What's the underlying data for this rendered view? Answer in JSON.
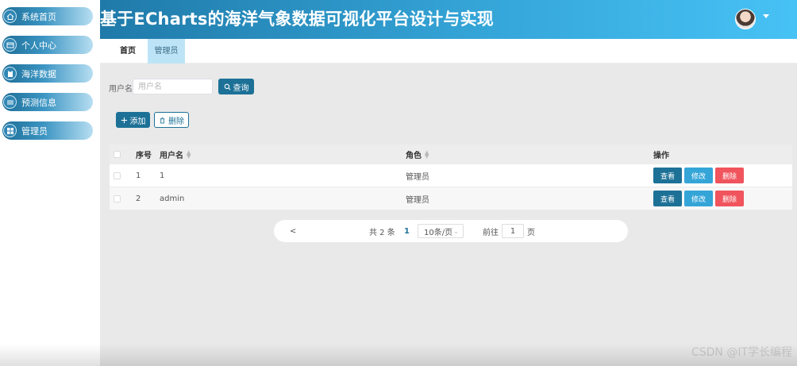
{
  "sidebar": {
    "items": [
      {
        "label": "系统首页",
        "icon": "home-icon"
      },
      {
        "label": "个人中心",
        "icon": "user-card-icon"
      },
      {
        "label": "海洋数据",
        "icon": "clipboard-icon"
      },
      {
        "label": "预测信息",
        "icon": "sliders-icon"
      },
      {
        "label": "管理员",
        "icon": "grid-icon"
      }
    ]
  },
  "header": {
    "title": "基于ECharts的海洋气象数据可视化平台设计与实现"
  },
  "tabs": [
    {
      "label": "首页"
    },
    {
      "label": "管理员"
    }
  ],
  "search": {
    "label": "用户名",
    "placeholder": "用户名",
    "query_label": "查询"
  },
  "actions": {
    "add_label": "添加",
    "delete_label": "删除"
  },
  "table": {
    "headers": {
      "index": "序号",
      "username": "用户名",
      "role": "角色",
      "ops": "操作"
    },
    "rows": [
      {
        "index": "1",
        "username": "1",
        "role": "管理员"
      },
      {
        "index": "2",
        "username": "admin",
        "role": "管理员"
      }
    ],
    "op_labels": {
      "view": "查看",
      "edit": "修改",
      "delete": "删除"
    }
  },
  "pagination": {
    "prev": "<",
    "total_text": "共 2 条",
    "current_page": "1",
    "page_size": "10条/页",
    "goto_prefix": "前往",
    "goto_value": "1",
    "goto_suffix": "页"
  },
  "watermark": "CSDN @IT学长编程",
  "colors": {
    "primary": "#1d7197",
    "info": "#35a5d8",
    "danger": "#f0545d"
  }
}
